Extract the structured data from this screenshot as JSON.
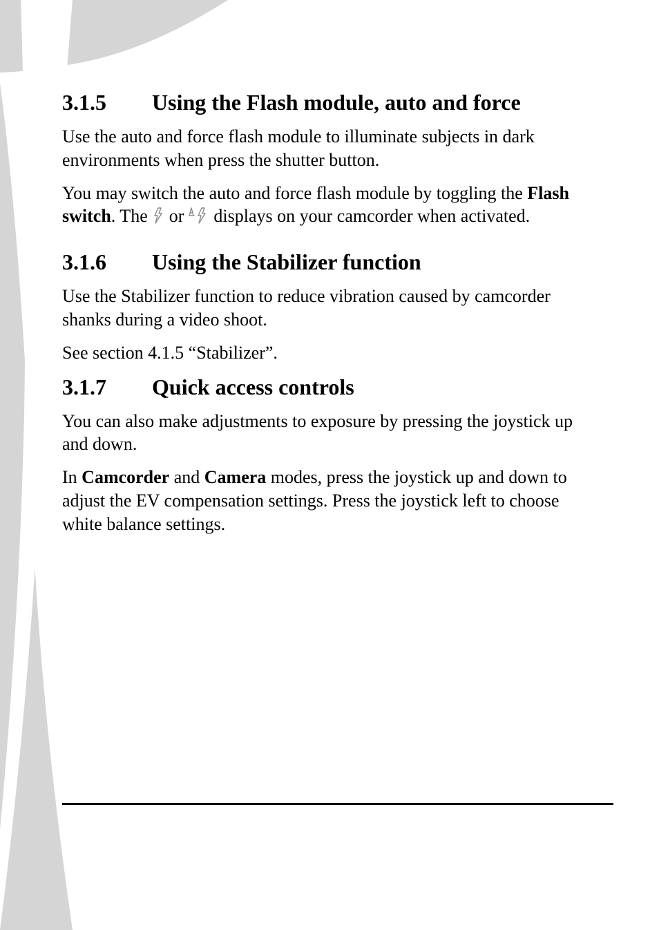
{
  "sections": {
    "s315": {
      "number": "3.1.5",
      "title": "Using the Flash module, auto and force",
      "p1": "Use the auto and force flash module to illuminate subjects in dark environments when press the shutter button.",
      "p2_a": "You may switch the auto and force flash module by toggling the ",
      "p2_b": "Flash switch",
      "p2_c": ". The ",
      "p2_d": " or ",
      "p2_e": " displays on your camcorder when activated."
    },
    "s316": {
      "number": "3.1.6",
      "title": "Using the Stabilizer function",
      "p1": "Use the Stabilizer function to reduce vibration caused by camcorder shanks during a video shoot.",
      "p2": "See section 4.1.5 “Stabilizer”."
    },
    "s317": {
      "number": "3.1.7",
      "title": "Quick access controls",
      "p1": "You can also make adjustments to exposure by pressing the joystick up and down.",
      "p2_a": "In ",
      "p2_b": "Camcorder",
      "p2_c": " and ",
      "p2_d": "Camera",
      "p2_e": " modes, press the joystick up and down to adjust the EV compensation settings. Press the joystick left to choose white balance settings."
    }
  }
}
